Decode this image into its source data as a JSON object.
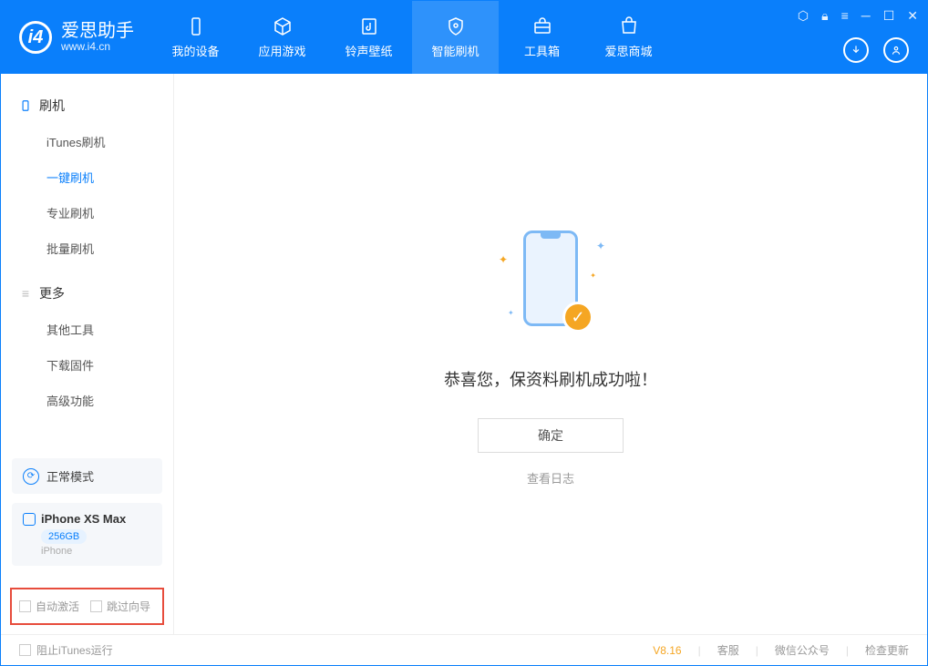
{
  "app": {
    "name": "爱思助手",
    "url": "www.i4.cn"
  },
  "nav": {
    "tabs": [
      {
        "label": "我的设备"
      },
      {
        "label": "应用游戏"
      },
      {
        "label": "铃声壁纸"
      },
      {
        "label": "智能刷机"
      },
      {
        "label": "工具箱"
      },
      {
        "label": "爱思商城"
      }
    ]
  },
  "sidebar": {
    "section1": {
      "title": "刷机"
    },
    "items1": [
      {
        "label": "iTunes刷机"
      },
      {
        "label": "一键刷机"
      },
      {
        "label": "专业刷机"
      },
      {
        "label": "批量刷机"
      }
    ],
    "section2": {
      "title": "更多"
    },
    "items2": [
      {
        "label": "其他工具"
      },
      {
        "label": "下载固件"
      },
      {
        "label": "高级功能"
      }
    ],
    "mode": "正常模式",
    "device": {
      "name": "iPhone XS Max",
      "storage": "256GB",
      "type": "iPhone"
    },
    "options": {
      "auto_activate": "自动激活",
      "skip_guide": "跳过向导"
    }
  },
  "main": {
    "success_text": "恭喜您，保资料刷机成功啦！",
    "confirm": "确定",
    "view_log": "查看日志"
  },
  "footer": {
    "block_itunes": "阻止iTunes运行",
    "version": "V8.16",
    "links": {
      "service": "客服",
      "wechat": "微信公众号",
      "update": "检查更新"
    }
  }
}
